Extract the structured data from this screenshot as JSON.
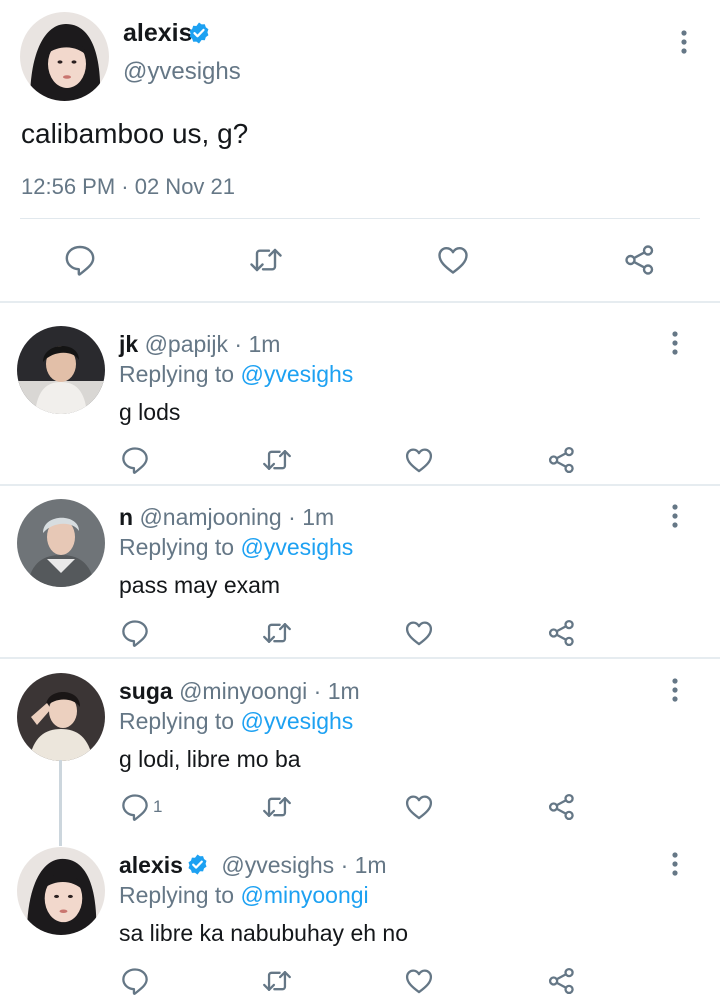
{
  "main_tweet": {
    "name": "alexis",
    "handle": "@yvesighs",
    "text": "calibamboo us, g?",
    "timestamp": "12:56 PM · 02 Nov 21",
    "verified": true
  },
  "replies": [
    {
      "name": "jk",
      "handle": "@papijk",
      "age": "1m",
      "replying_prefix": "Replying to",
      "replying_to": "@yvesighs",
      "text": "g lods"
    },
    {
      "name": "n",
      "handle": "@namjooning",
      "age": "1m",
      "replying_prefix": "Replying to",
      "replying_to": "@yvesighs",
      "text": "pass may exam"
    },
    {
      "name": "suga",
      "handle": "@minyoongi",
      "age": "1m",
      "replying_prefix": "Replying to",
      "replying_to": "@yvesighs",
      "text": "g lodi, libre mo ba",
      "reply_count": "1"
    },
    {
      "name": "alexis",
      "verified": true,
      "handle": "@yvesighs",
      "age": "1m",
      "replying_prefix": "Replying to",
      "replying_to": "@minyoongi",
      "text": "sa libre ka nabubuhay eh no"
    }
  ],
  "separator": "·",
  "icons": {
    "reply": "reply-icon",
    "retweet": "retweet-icon",
    "like": "heart-icon",
    "share": "share-icon",
    "more": "more-vertical-icon",
    "verified": "verified-badge-icon"
  },
  "colors": {
    "text": "#14171a",
    "secondary": "#657786",
    "link": "#1da1f2",
    "verified": "#1da1f2",
    "divider": "#e6ecf0"
  }
}
